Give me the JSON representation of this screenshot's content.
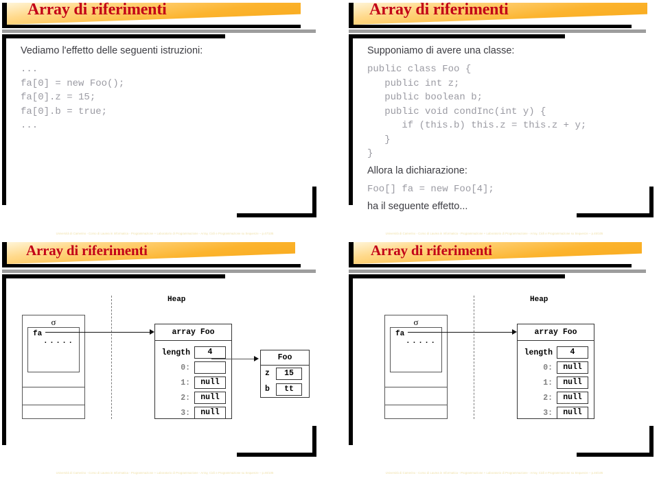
{
  "deck": {
    "title": "Array di riferimenti",
    "footer_prefix": "Università di Camerino - Corso di Laurea in Informatica - Programmazione + Laboratorio di Programmazione - Array, Cicli e Programmazione su Sequenze – "
  },
  "slides": {
    "top_left": {
      "title": "Array di riferimenti",
      "intro": "Vediamo l'effetto delle seguenti istruzioni:",
      "code": "...\nfa[0] = new Foo();\nfa[0].z = 15;\nfa[0].b = true;\n...",
      "footer": "Università di Camerino - Corso di Laurea in Informatica - Programmazione + Laboratorio di Programmazione - Array, Cicli e Programmazione su Sequenze – p.47/105"
    },
    "top_right": {
      "title": "Array di riferimenti",
      "intro": "Supponiamo di avere una classe:",
      "code": "public class Foo {\n   public int z;\n   public boolean b;\n   public void condInc(int y) {\n      if (this.b) this.z = this.z + y;\n   }\n}",
      "intro2": "Allora la dichiarazione:",
      "code2": "Foo[] fa = new Foo[4];",
      "outro": "ha il seguente effetto...",
      "footer": "Università di Camerino - Corso di Laurea in Informatica - Programmazione + Laboratorio di Programmazione - Array, Cicli e Programmazione su Sequenze – p.45/105"
    },
    "bottom_left": {
      "title": "Array di riferimenti",
      "footer": "Università di Camerino - Corso di Laurea in Informatica - Programmazione + Laboratorio di Programmazione - Array, Cicli e Programmazione su Sequenze – p.46/105",
      "diagram": {
        "heap_label": "Heap",
        "env": {
          "sigma": "σ",
          "var_name": "fa",
          "dots": "....."
        },
        "array": {
          "title": "array Foo",
          "length_label": "length",
          "length_value": "4",
          "slots": [
            {
              "index": "0:",
              "value": ""
            },
            {
              "index": "1:",
              "value": "null"
            },
            {
              "index": "2:",
              "value": "null"
            },
            {
              "index": "3:",
              "value": "null"
            }
          ]
        },
        "object": {
          "title": "Foo",
          "fields": [
            {
              "name": "z",
              "value": "15"
            },
            {
              "name": "b",
              "value": "tt"
            }
          ]
        }
      }
    },
    "bottom_right": {
      "title": "Array di riferimenti",
      "footer": "Università di Camerino - Corso di Laurea in Informatica - Programmazione + Laboratorio di Programmazione - Array, Cicli e Programmazione su Sequenze – p.46/105",
      "diagram": {
        "heap_label": "Heap",
        "env": {
          "sigma": "σ",
          "var_name": "fa",
          "dots": "....."
        },
        "array": {
          "title": "array Foo",
          "length_label": "length",
          "length_value": "4",
          "slots": [
            {
              "index": "0:",
              "value": "null"
            },
            {
              "index": "1:",
              "value": "null"
            },
            {
              "index": "2:",
              "value": "null"
            },
            {
              "index": "3:",
              "value": "null"
            }
          ]
        }
      }
    }
  },
  "colors": {
    "title_red": "#c20017",
    "banner_gold": "#fcb42e",
    "gray_rule": "#9d9d9d",
    "code_gray": "#9a9aa2",
    "prose_gray": "#3c3c42",
    "footer_cream": "#efe0a8"
  }
}
